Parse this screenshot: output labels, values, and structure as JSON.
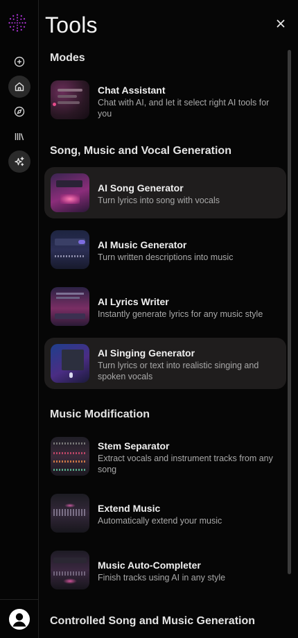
{
  "window": {
    "title": "Tools",
    "close_icon": "close-icon"
  },
  "rail": {
    "logo_icon": "dotted-circle-logo",
    "items": [
      {
        "icon": "plus-circle-icon",
        "active": false
      },
      {
        "icon": "home-icon",
        "active": true
      },
      {
        "icon": "compass-icon",
        "active": false
      },
      {
        "icon": "library-icon",
        "active": false
      },
      {
        "icon": "sparkles-icon",
        "active": true
      }
    ],
    "avatar_icon": "user-avatar-icon"
  },
  "sections": [
    {
      "title": "Modes"
    },
    {
      "title": "Song, Music and Vocal Generation"
    },
    {
      "title": "Music Modification"
    },
    {
      "title": "Controlled Song and Music Generation"
    }
  ],
  "tools": [
    {
      "name": "Chat Assistant",
      "desc": "Chat with AI, and let it select right AI tools for you",
      "highlighted": false
    },
    {
      "name": "AI Song Generator",
      "desc": "Turn lyrics into song with vocals",
      "highlighted": true
    },
    {
      "name": "AI Music Generator",
      "desc": "Turn written descriptions into music",
      "highlighted": false
    },
    {
      "name": "AI Lyrics Writer",
      "desc": "Instantly generate lyrics for any music style",
      "highlighted": false
    },
    {
      "name": "AI Singing Generator",
      "desc": "Turn lyrics or text into realistic singing and spoken vocals",
      "highlighted": true
    },
    {
      "name": "Stem Separator",
      "desc": "Extract vocals and instrument tracks from any song",
      "highlighted": false
    },
    {
      "name": "Extend Music",
      "desc": "Automatically extend your music",
      "highlighted": false
    },
    {
      "name": "Music Auto-Completer",
      "desc": "Finish tracks using AI in any style",
      "highlighted": false
    }
  ],
  "colors": {
    "accent": "#c23bd6",
    "panel_bg": "#060606",
    "highlight_bg": "#1f1d1d"
  }
}
